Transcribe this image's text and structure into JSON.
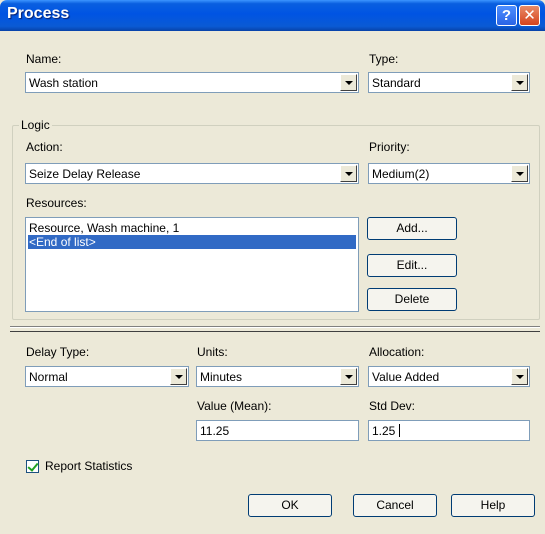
{
  "window": {
    "title": "Process"
  },
  "title_buttons": {
    "help": "?",
    "close": "✕"
  },
  "name": {
    "label": "Name:",
    "value": "Wash station"
  },
  "type": {
    "label": "Type:",
    "value": "Standard"
  },
  "logic": {
    "group_title": "Logic",
    "action": {
      "label": "Action:",
      "value": "Seize Delay Release"
    },
    "priority": {
      "label": "Priority:",
      "value": "Medium(2)"
    },
    "resources": {
      "label": "Resources:",
      "items": [
        "Resource, Wash machine, 1",
        "<End of list>"
      ],
      "selected_index": 1
    },
    "buttons": {
      "add": "Add...",
      "edit": "Edit...",
      "delete": "Delete"
    }
  },
  "delay_type": {
    "label": "Delay Type:",
    "value": "Normal"
  },
  "units": {
    "label": "Units:",
    "value": "Minutes"
  },
  "allocation": {
    "label": "Allocation:",
    "value": "Value Added"
  },
  "value_mean": {
    "label": "Value (Mean):",
    "value": "11.25"
  },
  "std_dev": {
    "label": "Std Dev:",
    "value": "1.25"
  },
  "report_statistics": {
    "label": "Report Statistics",
    "checked": true
  },
  "footer": {
    "ok": "OK",
    "cancel": "Cancel",
    "help": "Help"
  }
}
